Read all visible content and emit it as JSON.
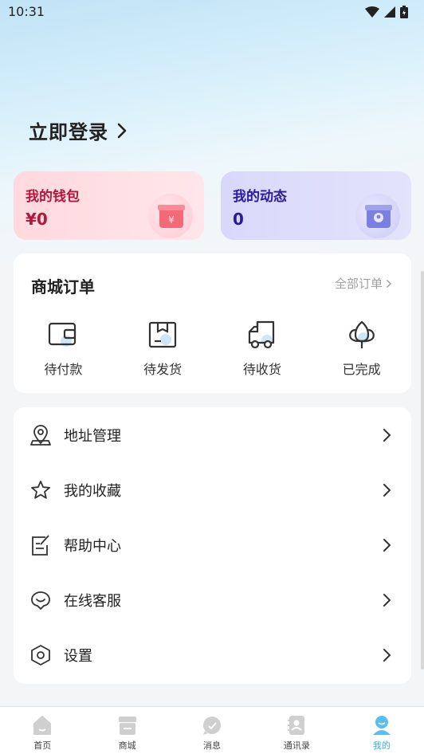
{
  "status_bar": {
    "time": "10:31"
  },
  "login": {
    "label": "立即登录"
  },
  "cards": {
    "wallet": {
      "title": "我的钱包",
      "value": "¥0"
    },
    "moments": {
      "title": "我的动态",
      "value": "0"
    }
  },
  "orders": {
    "title": "商城订单",
    "all_label": "全部订单",
    "items": [
      {
        "label": "待付款",
        "icon": "wallet-icon"
      },
      {
        "label": "待发货",
        "icon": "package-icon"
      },
      {
        "label": "待收货",
        "icon": "truck-icon"
      },
      {
        "label": "已完成",
        "icon": "flower-icon"
      }
    ]
  },
  "menu": {
    "items": [
      {
        "label": "地址管理",
        "icon": "location-icon"
      },
      {
        "label": "我的收藏",
        "icon": "star-icon"
      },
      {
        "label": "帮助中心",
        "icon": "note-edit-icon"
      },
      {
        "label": "在线客服",
        "icon": "chat-bubble-icon"
      },
      {
        "label": "设置",
        "icon": "settings-icon"
      }
    ]
  },
  "tabbar": {
    "tabs": [
      {
        "label": "首页",
        "icon": "home-icon"
      },
      {
        "label": "商城",
        "icon": "shop-icon"
      },
      {
        "label": "消息",
        "icon": "message-icon"
      },
      {
        "label": "通讯录",
        "icon": "contacts-icon"
      },
      {
        "label": "我的",
        "icon": "profile-icon",
        "active": true
      }
    ]
  },
  "colors": {
    "accent": "#3aa8e8",
    "wallet": "#b3173a",
    "moments": "#2a1a9c"
  }
}
